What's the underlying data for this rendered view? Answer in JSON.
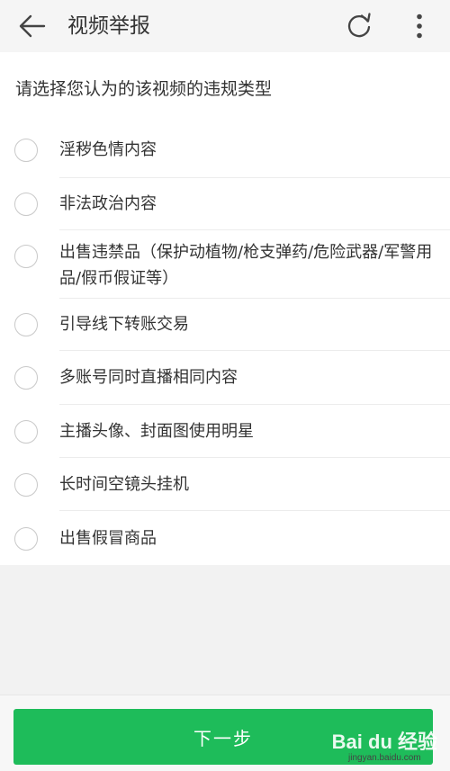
{
  "header": {
    "title": "视频举报",
    "back_icon": "arrow-left-icon",
    "refresh_icon": "refresh-icon",
    "more_icon": "more-vertical-icon"
  },
  "prompt": "请选择您认为的该视频的违规类型",
  "options": [
    {
      "label": "淫秽色情内容",
      "selected": false
    },
    {
      "label": "非法政治内容",
      "selected": false
    },
    {
      "label": "出售违禁品（保护动植物/枪支弹药/危险武器/军警用品/假币假证等）",
      "selected": false
    },
    {
      "label": "引导线下转账交易",
      "selected": false
    },
    {
      "label": "多账号同时直播相同内容",
      "selected": false
    },
    {
      "label": "主播头像、封面图使用明星",
      "selected": false
    },
    {
      "label": "长时间空镜头挂机",
      "selected": false
    },
    {
      "label": "出售假冒商品",
      "selected": false
    }
  ],
  "footer": {
    "next_label": "下一步"
  },
  "watermark": {
    "brand": "Bai du 经验",
    "url": "jingyan.baidu.com"
  },
  "colors": {
    "accent": "#1ebc5a",
    "header_bg": "#f5f5f5",
    "page_bg": "#f2f2f2"
  }
}
